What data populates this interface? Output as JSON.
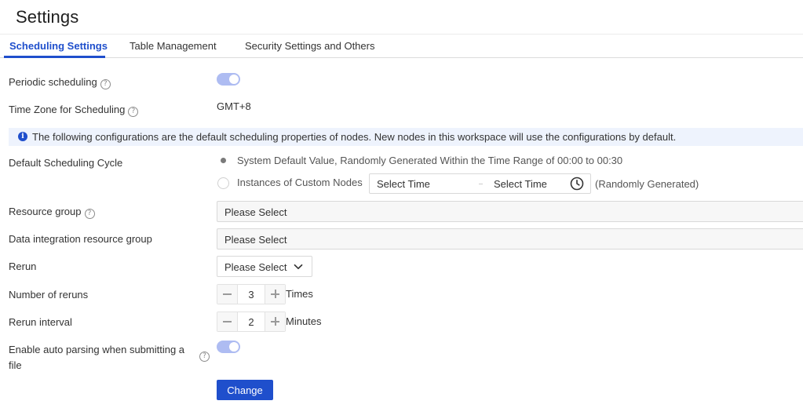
{
  "page": {
    "title": "Settings"
  },
  "tabs": [
    {
      "label": "Scheduling Settings",
      "active": true
    },
    {
      "label": "Table Management",
      "active": false
    },
    {
      "label": "Security Settings and Others",
      "active": false
    }
  ],
  "form": {
    "periodic_scheduling": {
      "label": "Periodic scheduling",
      "enabled": true
    },
    "time_zone": {
      "label": "Time Zone for Scheduling",
      "value": "GMT+8"
    },
    "info_banner": "The following configurations are the default scheduling properties of nodes. New nodes in this workspace will use the configurations by default.",
    "default_cycle": {
      "label": "Default Scheduling Cycle",
      "options": [
        {
          "label": "System Default Value, Randomly Generated Within the Time Range of 00:00 to 00:30",
          "selected": true
        },
        {
          "label": "Instances of Custom Nodes",
          "selected": false
        }
      ],
      "start_placeholder": "Select Time",
      "end_placeholder": "Select Time",
      "suffix": "(Randomly Generated)"
    },
    "resource_group": {
      "label": "Resource group",
      "placeholder": "Please Select"
    },
    "data_integration_group": {
      "label": "Data integration resource group",
      "placeholder": "Please Select"
    },
    "rerun": {
      "label": "Rerun",
      "placeholder": "Please Select"
    },
    "number_of_reruns": {
      "label": "Number of reruns",
      "value": "3",
      "unit": "Times"
    },
    "rerun_interval": {
      "label": "Rerun interval",
      "value": "2",
      "unit": "Minutes"
    },
    "auto_parsing": {
      "label_line1": "Enable auto parsing when submitting a",
      "label_line2": "file",
      "enabled": true
    }
  },
  "actions": {
    "change_label": "Change"
  },
  "colors": {
    "accent": "#1f4fcc",
    "toggle_on": "#aebcf2",
    "banner_bg": "#eef3fd"
  },
  "help_icon_glyph": "?",
  "info_icon_glyph": "i"
}
